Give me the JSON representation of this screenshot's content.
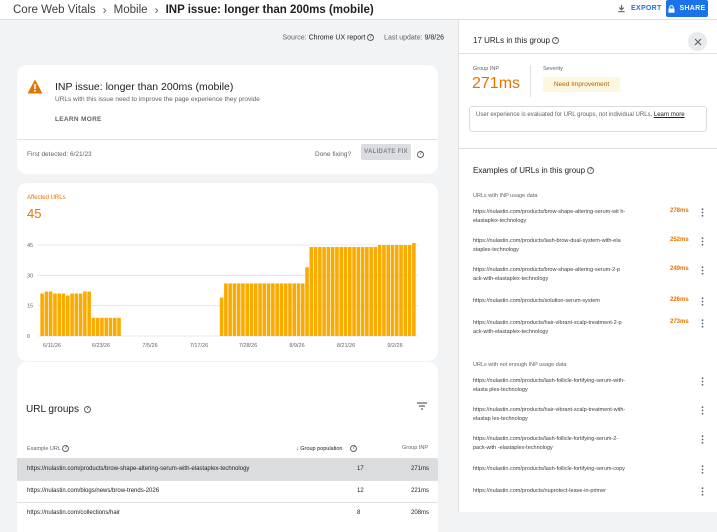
{
  "breadcrumb": [
    "Core Web Vitals",
    "Mobile",
    "INP issue: longer than 200ms (mobile)"
  ],
  "toolbar": {
    "export_label": "EXPORT",
    "share_label": "SHARE"
  },
  "source_line": {
    "source_label": "Source:",
    "source": "Chrome UX report",
    "update_label": "Last update:",
    "update": "9/8/26"
  },
  "issue": {
    "title": "INP issue: longer than 200ms (mobile)",
    "subtitle": "URLs with this issue need to improve the page experience they provide",
    "learn_more": "LEARN MORE",
    "first_detected": "First detected: 6/21/23",
    "done_fixing": "Done fixing?",
    "validate_label": "VALIDATE FIX"
  },
  "affected": {
    "label": "Affected URLs",
    "value": "45"
  },
  "chart_data": {
    "type": "bar",
    "yticks": [
      "45",
      "30",
      "15",
      "0"
    ],
    "ylim": [
      0,
      45
    ],
    "xticks": [
      "6/11/26",
      "6/23/26",
      "7/5/26",
      "7/17/26",
      "7/28/26",
      "8/9/26",
      "8/21/26",
      "9/2/26"
    ],
    "color": "#f9ab00",
    "values": [
      21,
      22,
      22,
      21,
      21,
      21,
      20,
      21,
      21,
      21,
      22,
      22,
      9,
      9,
      9,
      9,
      9,
      9,
      9,
      0,
      0,
      0,
      0,
      0,
      0,
      0,
      0,
      0,
      0,
      0,
      0,
      0,
      0,
      0,
      0,
      0,
      0,
      0,
      0,
      0,
      0,
      0,
      19,
      26,
      26,
      26,
      26,
      26,
      26,
      26,
      26,
      26,
      26,
      26,
      26,
      26,
      26,
      26,
      26,
      26,
      26,
      26,
      34,
      44,
      44,
      44,
      44,
      44,
      44,
      44,
      44,
      44,
      44,
      44,
      44,
      44,
      44,
      44,
      44,
      45,
      45,
      45,
      45,
      45,
      45,
      45,
      45,
      46
    ]
  },
  "url_groups": {
    "title": "URL groups",
    "col_url": "Example URL",
    "col_pop": "Group population",
    "col_inp": "Group INP",
    "rows": [
      {
        "url": "https://nulastin.com/products/brow-shape-altering-serum-with-elastaplex-technology",
        "pop": "17",
        "inp": "271ms"
      },
      {
        "url": "https://nulastin.com/blogs/news/brow-trends-2026",
        "pop": "12",
        "inp": "221ms"
      },
      {
        "url": "https://nulastin.com/collections/hair",
        "pop": "8",
        "inp": "208ms"
      }
    ]
  },
  "panel": {
    "title": "17 URLs in this group",
    "group_inp_label": "Group INP",
    "group_inp_value": "271ms",
    "severity_label": "Severity",
    "severity_value": "Need Improvement",
    "note": "User experience is evaluated for URL groups, not individual URLs.",
    "note_link": "Learn more",
    "examples_title": "Examples of URLs in this group",
    "with_data_label": "URLs with INP usage data",
    "with_data": [
      {
        "url": "https://nulastin.com/products/brow-shape-altering-serum-wit h-elastaplex-technology",
        "ms": "278ms"
      },
      {
        "url": "https://nulastin.com/products/lash-brow-dual-system-with-ela staplex-technology",
        "ms": "252ms"
      },
      {
        "url": "https://nulastin.com/products/brow-shape-altering-serum-2-p ack-with-elastaplex-technology",
        "ms": "249ms"
      },
      {
        "url": "https://nulastin.com/products/solution-serum-system",
        "ms": "226ms"
      },
      {
        "url": "https://nulastin.com/products/hair-vibrant-scalp-treatment-2-p ack-with-elastaplex-technology",
        "ms": "273ms"
      }
    ],
    "without_data_label": "URLs with not enough INP usage data",
    "without_data": [
      {
        "url": "https://nulastin.com/products/lash-follicle-fortifying-serum-with-elasta plex-technology"
      },
      {
        "url": "https://nulastin.com/products/hair-vibrant-scalp-treatment-with-elastap lex-technology"
      },
      {
        "url": "https://nulastin.com/products/lash-follicle-fortifying-serum-2-pack-with -elastaplex-technology"
      },
      {
        "url": "https://nulastin.com/products/lash-follicle-fortifying-serum-copy"
      },
      {
        "url": "https://nulastin.com/products/nuprotect-leave-in-primer"
      }
    ]
  }
}
